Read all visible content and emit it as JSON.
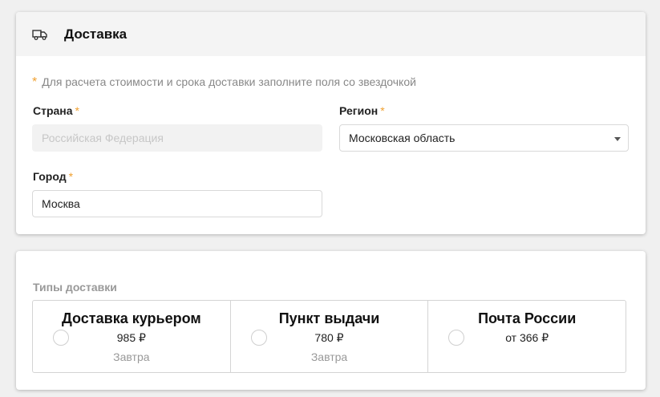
{
  "colors": {
    "accent": "#f0a030",
    "header_bg": "#f4f4f4"
  },
  "delivery": {
    "icon": "truck-icon",
    "title": "Доставка",
    "required_mark": "*",
    "hint": "Для расчета стоимости и срока доставки заполните поля со звездочкой",
    "country": {
      "label": "Страна",
      "value": "Российская Федерация",
      "disabled": true
    },
    "region": {
      "label": "Регион",
      "value": "Московская область"
    },
    "city": {
      "label": "Город",
      "value": "Москва"
    }
  },
  "delivery_types": {
    "label": "Типы доставки",
    "options": [
      {
        "name": "Доставка курьером",
        "price": "985 ₽",
        "when": "Завтра",
        "selected": false
      },
      {
        "name": "Пункт выдачи",
        "price": "780 ₽",
        "when": "Завтра",
        "selected": false
      },
      {
        "name": "Почта России",
        "price": "от 366 ₽",
        "when": "",
        "selected": false
      }
    ]
  }
}
